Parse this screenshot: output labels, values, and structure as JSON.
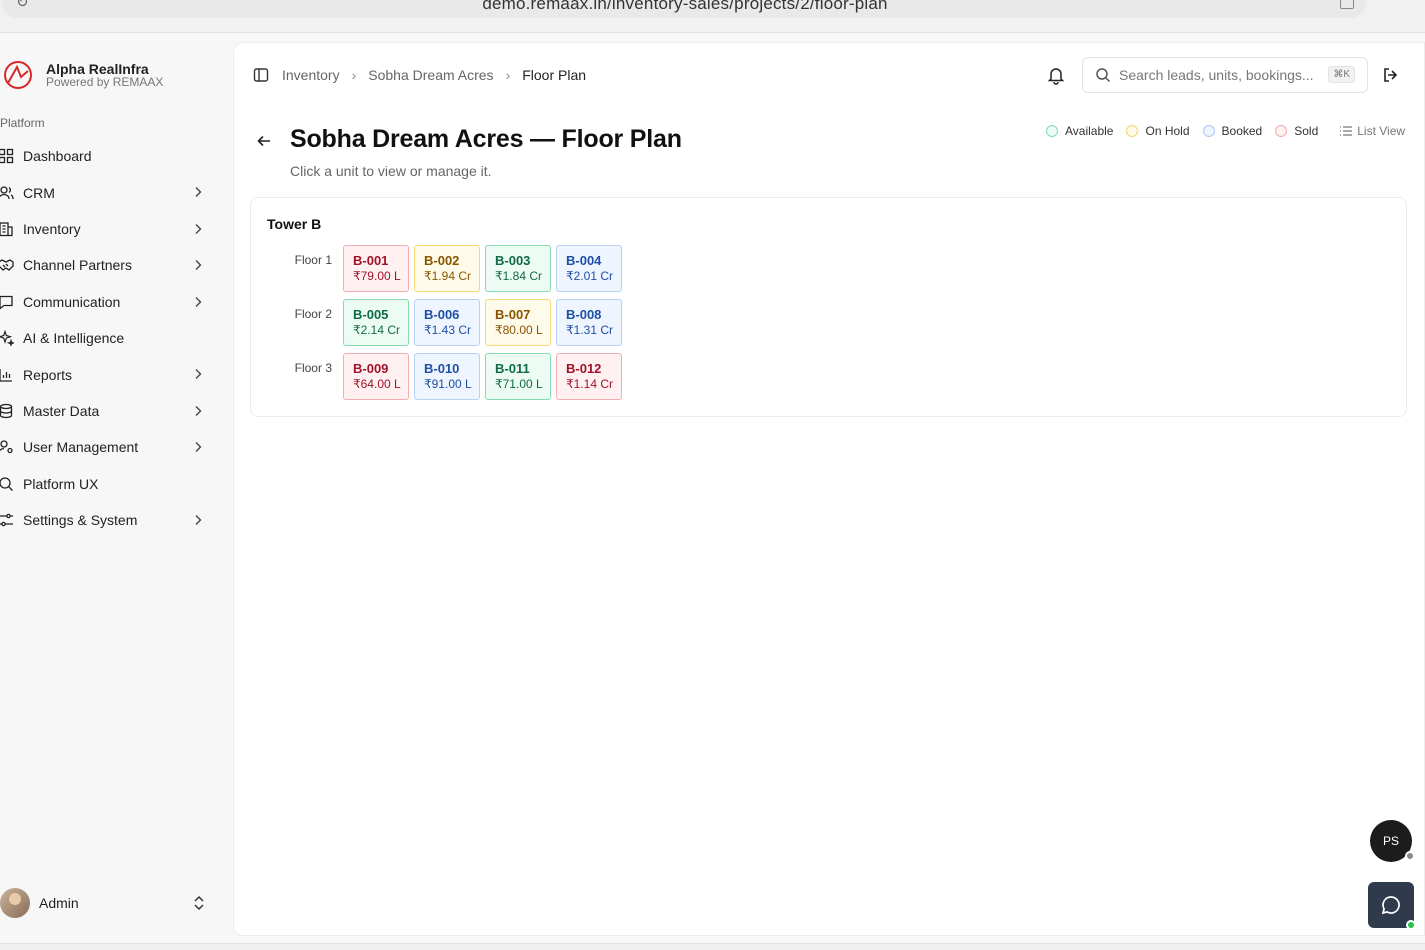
{
  "browser": {
    "url": "demo.remaax.in/inventory-sales/projects/2/floor-plan"
  },
  "brand": {
    "name": "Alpha RealInfra",
    "sub": "Powered by REMAAX"
  },
  "sidebar": {
    "section": "Platform",
    "items": [
      {
        "label": "Dashboard",
        "icon": "grid-icon",
        "chevron": false
      },
      {
        "label": "CRM",
        "icon": "users-icon",
        "chevron": true
      },
      {
        "label": "Inventory",
        "icon": "building-icon",
        "chevron": true
      },
      {
        "label": "Channel Partners",
        "icon": "handshake-icon",
        "chevron": true
      },
      {
        "label": "Communication",
        "icon": "message-icon",
        "chevron": true
      },
      {
        "label": "AI & Intelligence",
        "icon": "sparkles-icon",
        "chevron": false
      },
      {
        "label": "Reports",
        "icon": "bar-chart-icon",
        "chevron": true
      },
      {
        "label": "Master Data",
        "icon": "database-icon",
        "chevron": true
      },
      {
        "label": "User Management",
        "icon": "user-cog-icon",
        "chevron": true
      },
      {
        "label": "Platform UX",
        "icon": "search-icon",
        "chevron": false
      },
      {
        "label": "Settings & System",
        "icon": "sliders-icon",
        "chevron": true
      }
    ],
    "user": {
      "name": "Admin"
    }
  },
  "header": {
    "breadcrumbs": [
      "Inventory",
      "Sobha Dream Acres",
      "Floor Plan"
    ],
    "search_placeholder": "Search leads, units, bookings...",
    "search_shortcut": "⌘K"
  },
  "page": {
    "title": "Sobha Dream Acres — Floor Plan",
    "subtitle": "Click a unit to view or manage it."
  },
  "legend": {
    "items": [
      {
        "label": "Available",
        "key": "available"
      },
      {
        "label": "On Hold",
        "key": "hold"
      },
      {
        "label": "Booked",
        "key": "booked"
      },
      {
        "label": "Sold",
        "key": "sold"
      }
    ],
    "list_view_label": "List View"
  },
  "status_colors": {
    "available": {
      "bg": "#ecfbf3",
      "border": "#86dbb0",
      "text": "#0f6b45",
      "dot": "#7fd9b6"
    },
    "hold": {
      "bg": "#fffbea",
      "border": "#f7d97a",
      "text": "#8a5300",
      "dot": "#f5d46b"
    },
    "booked": {
      "bg": "#eef5ff",
      "border": "#b7d0f3",
      "text": "#1e4fa6",
      "dot": "#a9c8f0"
    },
    "sold": {
      "bg": "#fff1f1",
      "border": "#f2aeb0",
      "text": "#a1122a",
      "dot": "#f3a9ad"
    }
  },
  "tower": {
    "name": "Tower B",
    "floors": [
      {
        "label": "Floor 1",
        "units": [
          {
            "code": "B-001",
            "price": "₹79.00 L",
            "status": "sold"
          },
          {
            "code": "B-002",
            "price": "₹1.94 Cr",
            "status": "hold"
          },
          {
            "code": "B-003",
            "price": "₹1.84 Cr",
            "status": "available"
          },
          {
            "code": "B-004",
            "price": "₹2.01 Cr",
            "status": "booked"
          }
        ]
      },
      {
        "label": "Floor 2",
        "units": [
          {
            "code": "B-005",
            "price": "₹2.14 Cr",
            "status": "available"
          },
          {
            "code": "B-006",
            "price": "₹1.43 Cr",
            "status": "booked"
          },
          {
            "code": "B-007",
            "price": "₹80.00 L",
            "status": "hold"
          },
          {
            "code": "B-008",
            "price": "₹1.31 Cr",
            "status": "booked"
          }
        ]
      },
      {
        "label": "Floor 3",
        "units": [
          {
            "code": "B-009",
            "price": "₹64.00 L",
            "status": "sold"
          },
          {
            "code": "B-010",
            "price": "₹91.00 L",
            "status": "booked"
          },
          {
            "code": "B-011",
            "price": "₹71.00 L",
            "status": "available"
          },
          {
            "code": "B-012",
            "price": "₹1.14 Cr",
            "status": "sold"
          }
        ]
      }
    ]
  },
  "fab": {
    "avatar_initials": "PS"
  }
}
